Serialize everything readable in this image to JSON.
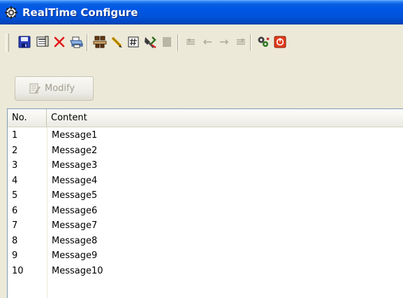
{
  "window": {
    "title": "RealTime Configure",
    "icon": "gear-icon",
    "accent_color": "#0058e6"
  },
  "toolbar": {
    "buttons": [
      {
        "name": "save-button",
        "icon": "floppy-disk-icon",
        "enabled": true
      },
      {
        "name": "preview-button",
        "icon": "preview-icon",
        "enabled": true
      },
      {
        "name": "delete-button",
        "icon": "red-x-icon",
        "enabled": true
      },
      {
        "name": "print-button",
        "icon": "printer-icon",
        "enabled": true
      },
      {
        "name": "connect-button",
        "icon": "network-icon",
        "enabled": true
      },
      {
        "name": "edit-button",
        "icon": "pencil-icon",
        "enabled": true
      },
      {
        "name": "number-button",
        "icon": "hash-icon",
        "enabled": true
      },
      {
        "name": "tools-button",
        "icon": "tools-icon",
        "enabled": true
      },
      {
        "name": "stop-button",
        "icon": "gray-square-icon",
        "enabled": false
      },
      {
        "name": "align-left-button",
        "icon": "align-left-icon",
        "enabled": false
      },
      {
        "name": "arrow-left-button",
        "icon": "arrow-left-icon",
        "enabled": false
      },
      {
        "name": "arrow-right-button",
        "icon": "arrow-right-icon",
        "enabled": false
      },
      {
        "name": "align-right-button",
        "icon": "align-right-icon",
        "enabled": false
      },
      {
        "name": "settings-button",
        "icon": "gears-icon",
        "enabled": true
      },
      {
        "name": "power-button",
        "icon": "power-icon",
        "enabled": true
      }
    ]
  },
  "modify_button": {
    "label": "Modify",
    "icon": "modify-icon",
    "enabled": false
  },
  "list": {
    "columns": [
      "No.",
      "Content"
    ],
    "rows": [
      {
        "no": "1",
        "content": "Message1"
      },
      {
        "no": "2",
        "content": "Message2"
      },
      {
        "no": "3",
        "content": "Message3"
      },
      {
        "no": "4",
        "content": "Message4"
      },
      {
        "no": "5",
        "content": "Message5"
      },
      {
        "no": "6",
        "content": "Message6"
      },
      {
        "no": "7",
        "content": "Message7"
      },
      {
        "no": "8",
        "content": "Message8"
      },
      {
        "no": "9",
        "content": "Message9"
      },
      {
        "no": "10",
        "content": "Message10"
      }
    ]
  }
}
